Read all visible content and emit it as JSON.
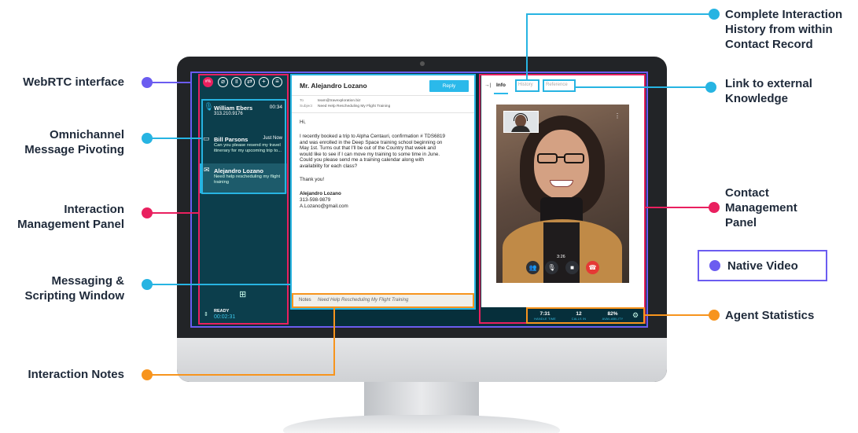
{
  "callouts": {
    "webrtc": "WebRTC interface",
    "omnichannel": "Omnichannel\nMessage Pivoting",
    "interaction_mgmt": "Interaction\nManagement Panel",
    "messaging": "Messaging &\nScripting Window",
    "notes": "Interaction Notes",
    "history": "Complete Interaction\nHistory from within\nContact Record",
    "knowledge": "Link to external\nKnowledge",
    "contact_mgmt": "Contact\nManagement\nPanel",
    "native_video": "Native Video",
    "agent_stats": "Agent Statistics"
  },
  "colors": {
    "purple": "#6b5cf0",
    "cyan": "#27b4e2",
    "pink": "#e9205f",
    "orange": "#f7941d",
    "sidebar_bg": "#0c3e4c",
    "sidebar_active": "#1d5b6b",
    "reply": "#2bb9ea"
  },
  "toolbar": {
    "end_call": "#%",
    "icons": [
      "mic-off-icon",
      "pause-icon",
      "transfer-icon",
      "add-icon",
      "list-icon"
    ]
  },
  "sidebar": {
    "items": [
      {
        "name": "William Ebers",
        "detail": "313.210.9176",
        "time": "00:34"
      },
      {
        "name": "Bill Parsons",
        "detail": "Can you please resend my travel itinerary for my upcoming trip to...",
        "time": "Just Now"
      },
      {
        "name": "Alejandro Lozano",
        "detail": "Need help rescheduling my flight training",
        "time": ""
      }
    ],
    "status": "READY",
    "timer": "00:02:31"
  },
  "email": {
    "title": "Mr. Alejandro Lozano",
    "reply_label": "Reply",
    "to_label": "To",
    "to_value": "team@travexploration.biz",
    "subject_label": "Subject",
    "subject_value": "Need Help Rescheduling My Flight Training",
    "greeting": "Hi,",
    "paragraph": "I recently booked a trip to Alpha Centauri, confirmation # TDS6819 and was enrolled in the Deep Space training school beginning on May 1st. Turns out that I'll be out of the Country that week and would like to see if I can move my training to some time in June. Could you please send me a training calendar along with availability for each class?",
    "thanks": "Thank you!",
    "signature_name": "Alejandro Lozano",
    "signature_phone": "313-598-9879",
    "signature_email": "A.Lozano@gmail.com",
    "notes_label": "Notes",
    "notes_value": "Need Help Rescheduling My Flight Training"
  },
  "contact": {
    "collapse_glyph": "→|",
    "tabs": [
      "Info",
      "History",
      "Reference"
    ],
    "call_time": "3:26"
  },
  "stats": [
    {
      "value": "7:31",
      "label": "HANDLE TIME"
    },
    {
      "value": "12",
      "label": "CALLS IN"
    },
    {
      "value": "82%",
      "label": "AVAILABILITY"
    }
  ]
}
